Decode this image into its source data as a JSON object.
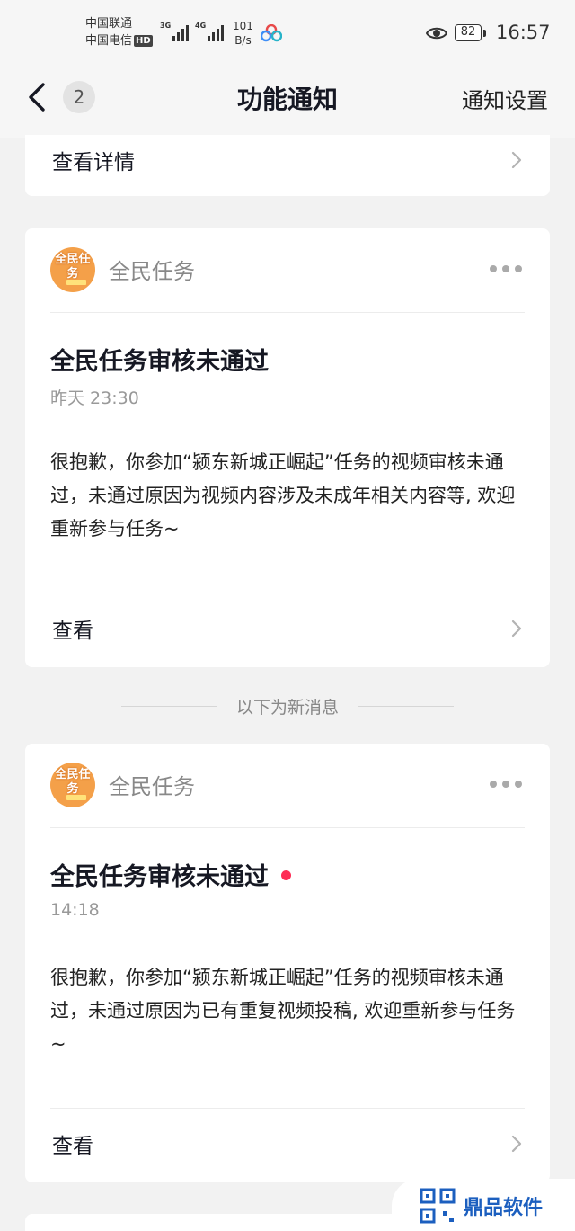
{
  "status_bar": {
    "carrier_1": "中国联通",
    "carrier_2": "中国电信",
    "hd_badge": "HD",
    "signal_1_gen": "3G",
    "signal_2_gen": "4G",
    "net_speed_value": "101",
    "net_speed_unit": "B/s",
    "battery": "82",
    "time": "16:57"
  },
  "nav": {
    "back_icon": "chevron-left-icon",
    "unread_count": "2",
    "title": "功能通知",
    "settings_label": "通知设置"
  },
  "top_card": {
    "action_label": "查看详情"
  },
  "separator": {
    "label": "以下为新消息"
  },
  "messages": [
    {
      "sender": "全民任务",
      "avatar_text": "全民任务",
      "title": "全民任务审核未通过",
      "time": "昨天 23:30",
      "body": "很抱歉，你参加“颍东新城正崛起”任务的视频审核未通过，未通过原因为视频内容涉及未成年相关内容等, 欢迎重新参与任务~",
      "action_label": "查看",
      "unread": false
    },
    {
      "sender": "全民任务",
      "avatar_text": "全民任务",
      "title": "全民任务审核未通过",
      "time": "14:18",
      "body": "很抱歉，你参加“颍东新城正崛起”任务的视频审核未通过，未通过原因为已有重复视频投稿, 欢迎重新参与任务~",
      "action_label": "查看",
      "unread": true
    }
  ],
  "watermark": {
    "text": "鼎品软件"
  },
  "colors": {
    "unread_dot": "#fe2c55",
    "avatar_bg": "#f4a049",
    "page_bg": "#f2f2f2"
  }
}
